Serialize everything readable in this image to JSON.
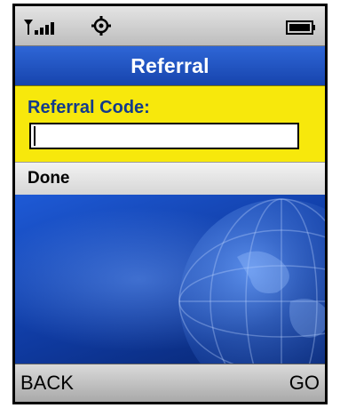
{
  "screen": {
    "title": "Referral"
  },
  "form": {
    "label": "Referral Code:",
    "value": "",
    "placeholder": ""
  },
  "menu": {
    "items": [
      {
        "label": "Done"
      }
    ]
  },
  "softkeys": {
    "left": "BACK",
    "right": "GO"
  },
  "icons": {
    "signal": "signal-strength-icon",
    "settings": "gear-icon",
    "battery": "battery-icon"
  },
  "colors": {
    "title_bar": "#1f52c4",
    "form_panel": "#f7e80c",
    "label_text": "#123a8c",
    "wallpaper": "#123b8f"
  }
}
